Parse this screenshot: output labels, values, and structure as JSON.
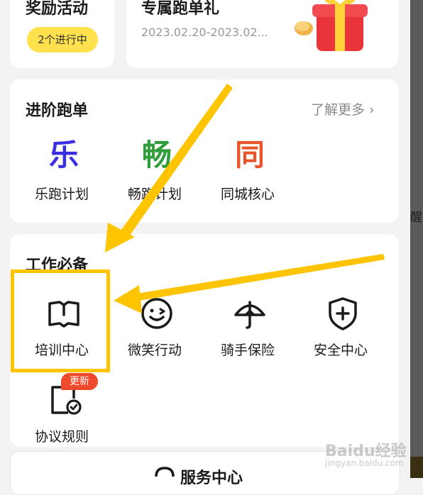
{
  "rewards": {
    "title": "奖励活动",
    "status_pill": "2个进行中"
  },
  "exclusive": {
    "title": "专属跑单礼",
    "date_range": "2023.02.20-2023.02..."
  },
  "advanced": {
    "title": "进阶跑单",
    "more_label": "了解更多",
    "items": [
      {
        "glyph": "乐",
        "label": "乐跑计划",
        "color": "#3a2fe0"
      },
      {
        "glyph": "畅",
        "label": "畅跑计划",
        "color": "#2f9e3a"
      },
      {
        "glyph": "同",
        "label": "同城核心",
        "color": "#e8552a"
      }
    ]
  },
  "work": {
    "title": "工作必备",
    "items": [
      {
        "label": "培训中心",
        "icon": "book-icon"
      },
      {
        "label": "微笑行动",
        "icon": "smile-icon"
      },
      {
        "label": "骑手保险",
        "icon": "umbrella-icon"
      },
      {
        "label": "安全中心",
        "icon": "shield-plus-icon"
      },
      {
        "label": "协议规则",
        "icon": "document-check-icon",
        "badge": "更新"
      }
    ]
  },
  "service": {
    "title": "服务中心"
  },
  "side_text": "醒",
  "watermark": {
    "main": "Baidu经验",
    "sub": "jingyan.baidu.com"
  },
  "colors": {
    "accent_yellow": "#ffc400",
    "badge_red": "#ef4a2c",
    "pill_yellow": "#ffe14d"
  }
}
